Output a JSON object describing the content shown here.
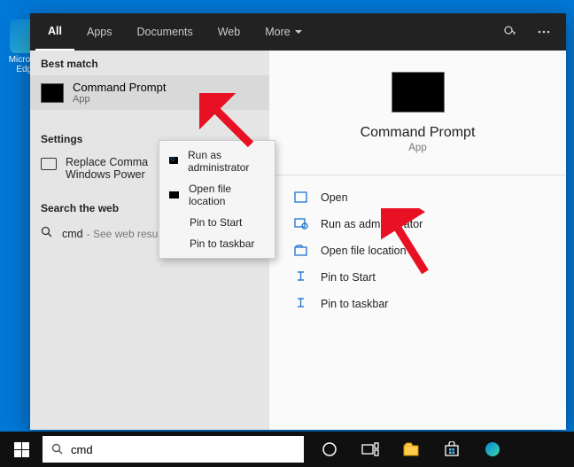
{
  "desktop": {
    "edge_label": "Microsoft Edge"
  },
  "tabs": {
    "all": "All",
    "apps": "Apps",
    "documents": "Documents",
    "web": "Web",
    "more": "More"
  },
  "left": {
    "best_match_head": "Best match",
    "cmd_title": "Command Prompt",
    "cmd_sub": "App",
    "settings_head": "Settings",
    "settings_item": "Replace Command Prompt with Windows PowerShell",
    "settings_item_visible": "Replace Comma…\nWindows Power…",
    "search_web_head": "Search the web",
    "web_term": "cmd",
    "web_sub": "- See web results"
  },
  "context_menu": {
    "run_admin": "Run as administrator",
    "open_loc": "Open file location",
    "pin_start": "Pin to Start",
    "pin_taskbar": "Pin to taskbar"
  },
  "preview": {
    "title": "Command Prompt",
    "sub": "App",
    "actions": {
      "open": "Open",
      "run_admin": "Run as administrator",
      "open_loc": "Open file location",
      "pin_start": "Pin to Start",
      "pin_taskbar": "Pin to taskbar"
    }
  },
  "taskbar": {
    "search_value": "cmd"
  }
}
